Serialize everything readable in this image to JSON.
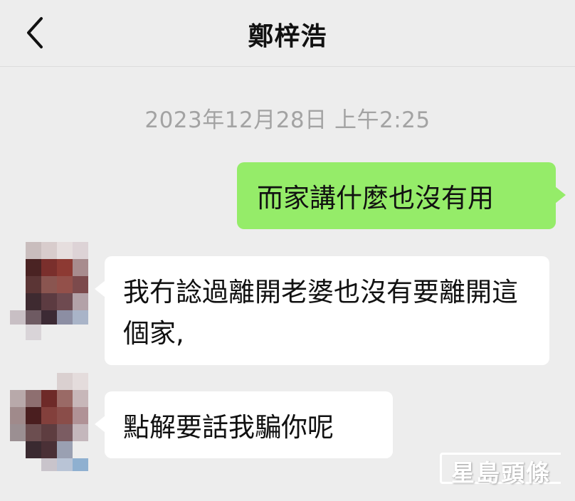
{
  "header": {
    "back_icon": "chevron-left-icon",
    "title": "鄭梓浩"
  },
  "chat": {
    "timestamp": "2023年12月28日 上午2:25",
    "messages": [
      {
        "side": "outgoing",
        "text": "而家講什麼也沒有用"
      },
      {
        "side": "incoming",
        "text": "我冇諗過離開老婆也沒有要離開這個家,"
      },
      {
        "side": "incoming",
        "text": "點解要話我騙你呢"
      }
    ]
  },
  "watermark": {
    "text": "星島頭條"
  },
  "colors": {
    "background": "#ededed",
    "outgoing_bubble": "#95ec69",
    "incoming_bubble": "#ffffff",
    "timestamp": "#a3a3a3"
  }
}
